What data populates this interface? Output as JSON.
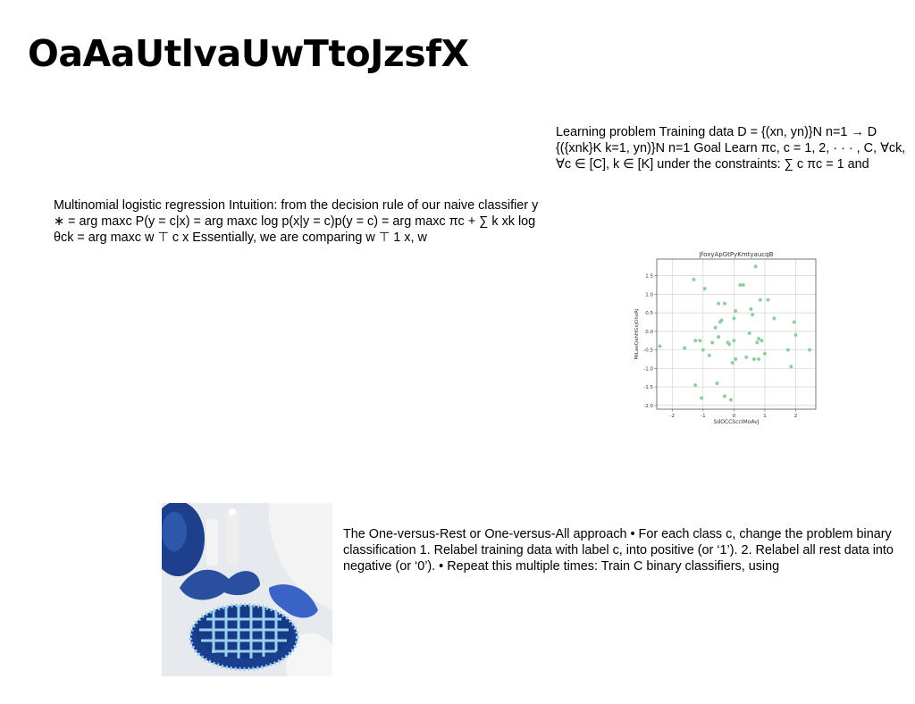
{
  "slide": {
    "title": "OaAaUtlvaUwTtoJzsfX",
    "text_blocks": [
      "Learning problem Training data D = {(xn, yn)}N n=1 → D {({xnk}K k=1, yn)}N n=1 Goal Learn πc, c = 1, 2, · · · , C, ∀ck, ∀c ∈ [C], k ∈ [K] under the constraints: ∑ c πc = 1 and",
      "Multinomial logistic regression Intuition: from the decision rule of our naive classifier y ∗ = arg maxc P(y = c|x) = arg maxc log p(x|y = c)p(y = c) = arg maxc πc + ∑ k xk log θck = arg maxc w ⊤ c x Essentially, we are comparing w ⊤ 1 x, w",
      "The One-versus-Rest or One-versus-All approach • For each class c, change the problem binary classification 1. Relabel training data with label c, into positive (or ‘1’). 2. Relabel all rest data into negative (or ‘0’). • Repeat this multiple times: Train C binary classifiers, using"
    ],
    "photo": {
      "icon": "photo-blue-cake-candles",
      "colors": {
        "background": "#e6eaee",
        "cake": "#1b3f8f",
        "cake_icing": "#9bd0ef",
        "candles": "#f2f2f2",
        "fabric": "#f5f5f5"
      }
    }
  },
  "chart_data": {
    "type": "scatter",
    "title": "JfoxyApGtPyKmtyaucqB",
    "xlabel": "SdOCCSccIMoAvJ",
    "ylabel": "MiLaeQahHGxjOhxRj",
    "xlim": [
      -2.5,
      2.65
    ],
    "ylim": [
      -2.1,
      1.95
    ],
    "xticks": [
      -2,
      -1,
      0,
      1,
      2
    ],
    "yticks": [
      -2.0,
      -1.5,
      -1.0,
      -0.5,
      0.0,
      0.5,
      1.0,
      1.5
    ],
    "grid": true,
    "point_color": "#8fcf9f",
    "x": [
      -2.4,
      -1.6,
      -1.3,
      -1.25,
      -1.25,
      -1.1,
      -1.05,
      -1.0,
      -0.95,
      -0.8,
      -0.7,
      -0.6,
      -0.55,
      -0.5,
      -0.5,
      -0.45,
      -0.4,
      -0.3,
      -0.3,
      -0.2,
      -0.15,
      -0.1,
      -0.05,
      0.0,
      0.0,
      0.05,
      0.05,
      0.2,
      0.3,
      0.4,
      0.5,
      0.55,
      0.6,
      0.65,
      0.7,
      0.75,
      0.8,
      0.8,
      0.85,
      0.9,
      1.0,
      1.1,
      1.3,
      1.75,
      1.85,
      1.95,
      2.0,
      2.45
    ],
    "y": [
      -0.4,
      -0.45,
      1.4,
      -0.25,
      -1.45,
      -0.25,
      -1.8,
      -0.5,
      1.15,
      -0.65,
      -0.3,
      0.1,
      -1.4,
      -0.15,
      0.75,
      0.25,
      0.3,
      -1.75,
      0.75,
      -0.3,
      -0.35,
      -1.85,
      -0.85,
      0.35,
      -0.25,
      -0.75,
      0.55,
      1.25,
      1.25,
      -0.7,
      -0.05,
      0.6,
      0.45,
      -0.75,
      1.75,
      -0.3,
      -0.2,
      -0.75,
      0.85,
      -0.25,
      -0.6,
      0.85,
      0.35,
      -0.5,
      -0.95,
      0.25,
      -0.1,
      -0.5
    ]
  }
}
